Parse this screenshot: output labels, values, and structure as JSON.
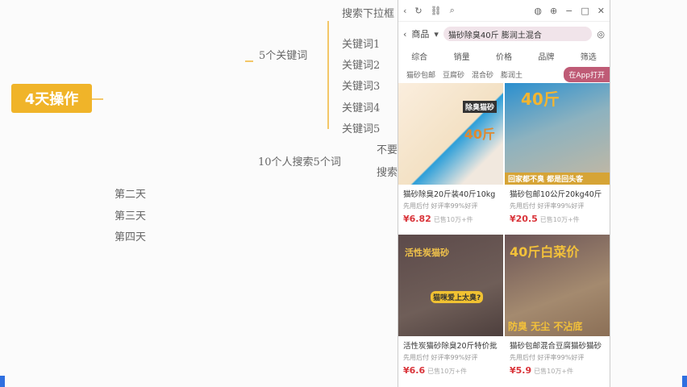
{
  "mindmap": {
    "root": "4天操作",
    "branch_keywords": "5个关键词",
    "keywords": [
      "关键词1",
      "关键词2",
      "关键词3",
      "关键词4",
      "关键词5"
    ],
    "top_partial": "搜索下拉框",
    "branch_search": "10个人搜索5个词",
    "partial_a": "不要",
    "partial_b": "搜索",
    "days": [
      "第二天",
      "第三天",
      "第四天"
    ]
  },
  "phone": {
    "category": "商品",
    "query": "猫砂除臭40斤 膨润土混合",
    "sort": [
      "综合",
      "销量",
      "价格",
      "品牌",
      "筛选"
    ],
    "filters": [
      "猫砂包邮",
      "豆腐砂",
      "混合砂",
      "膨润土"
    ],
    "open_app": "在App打开",
    "products": [
      {
        "title": "猫砂除臭20斤装40斤10kg",
        "meta": "先用后付 好评率99%好评",
        "price": "¥6.82",
        "sold": "已售10万+件",
        "img_big": "40斤",
        "img_small": "除臭猫砂"
      },
      {
        "title": "猫砂包邮10公斤20kg40斤",
        "meta": "先用后付 好评率99%好评",
        "price": "¥20.5",
        "sold": "已售10万+件",
        "img_big": "40斤",
        "img_small": "回家都不臭 都是回头客"
      },
      {
        "title": "活性炭猫砂除臭20斤特价批",
        "meta": "先用后付 好评率99%好评",
        "price": "¥6.6",
        "sold": "已售10万+件",
        "img_big": "活性炭猫砂",
        "img_small": "猫咪爱上太臭?"
      },
      {
        "title": "猫砂包邮混合豆腐猫砂猫砂",
        "meta": "先用后付 好评率99%好评",
        "price": "¥5.9",
        "sold": "已售10万+件",
        "img_big": "40斤白菜价",
        "img_small": "防臭 无尘 不沾底"
      }
    ]
  }
}
